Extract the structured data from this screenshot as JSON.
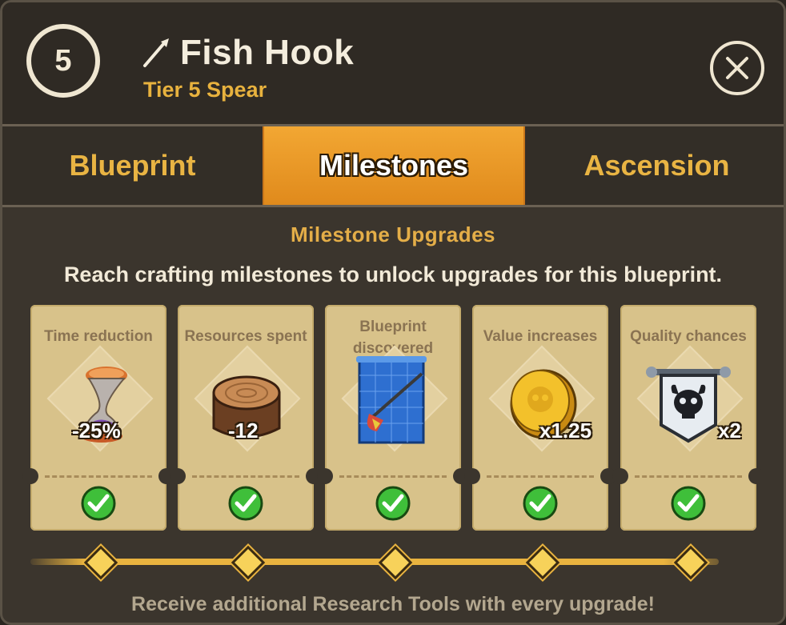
{
  "header": {
    "tier_number": "5",
    "title": "Fish Hook",
    "subtitle": "Tier 5 Spear",
    "icon": "spear-icon",
    "close_icon": "close-icon"
  },
  "tabs": [
    {
      "label": "Blueprint",
      "active": false
    },
    {
      "label": "Milestones",
      "active": true
    },
    {
      "label": "Ascension",
      "active": false
    }
  ],
  "section": {
    "title": "Milestone Upgrades",
    "description": "Reach crafting milestones to unlock upgrades for this blueprint."
  },
  "milestones": [
    {
      "label": "Time reduction",
      "value": "-25%",
      "icon": "hourglass-icon",
      "completed": true
    },
    {
      "label": "Resources spent",
      "value": "-12",
      "icon": "wood-log-icon",
      "completed": true
    },
    {
      "label": "Blueprint discovered",
      "value": "",
      "icon": "blueprint-scroll-icon",
      "completed": true
    },
    {
      "label": "Value increases",
      "value": "x1.25",
      "icon": "gold-coin-icon",
      "completed": true
    },
    {
      "label": "Quality chances",
      "value": "x2",
      "icon": "skull-banner-icon",
      "completed": true
    }
  ],
  "footer": "Receive additional Research Tools with every upgrade!",
  "colors": {
    "accent": "#e9b33f",
    "active_tab": "#f2a733",
    "card": "#d8c28a",
    "check_green": "#3fbf3a"
  }
}
